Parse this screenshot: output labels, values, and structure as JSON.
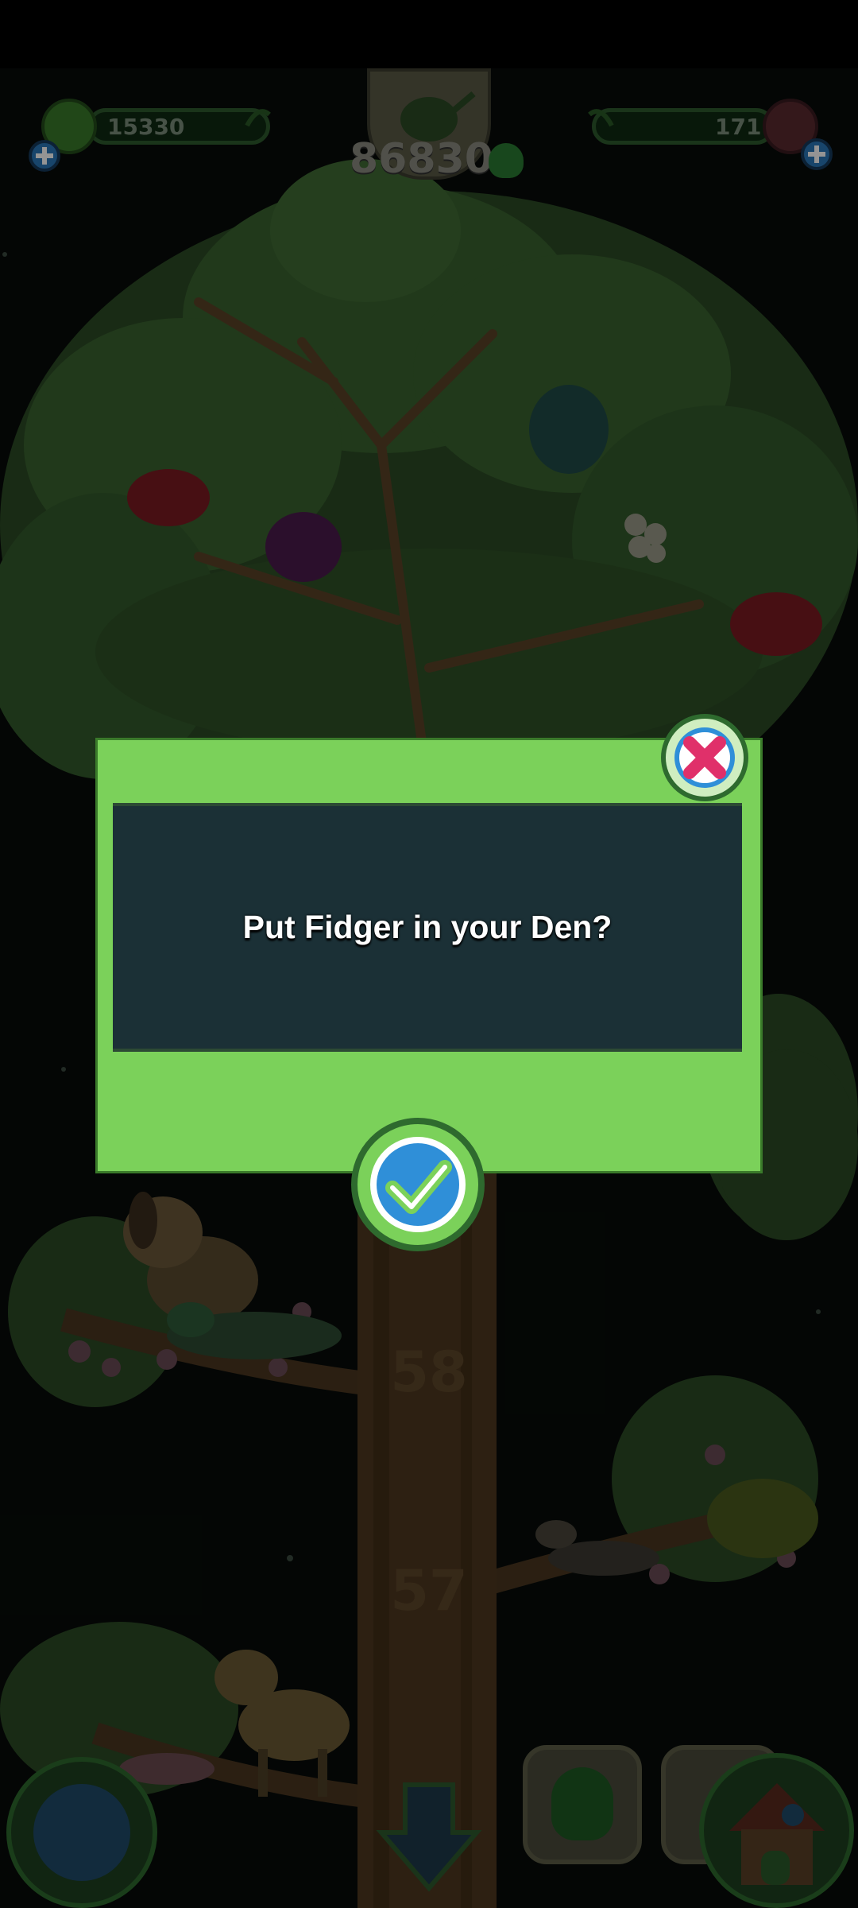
{
  "hud": {
    "left_currency": "15330",
    "center_currency": "86830",
    "right_currency": "171"
  },
  "tree": {
    "level_upper": "58",
    "level_lower": "57"
  },
  "dialog": {
    "message": "Put Fidger in your Den?"
  },
  "colors": {
    "dialog_frame": "#7bd15a",
    "dialog_panel": "#1b3036",
    "accept": "#2f8fd8",
    "close": "#e0306a"
  }
}
